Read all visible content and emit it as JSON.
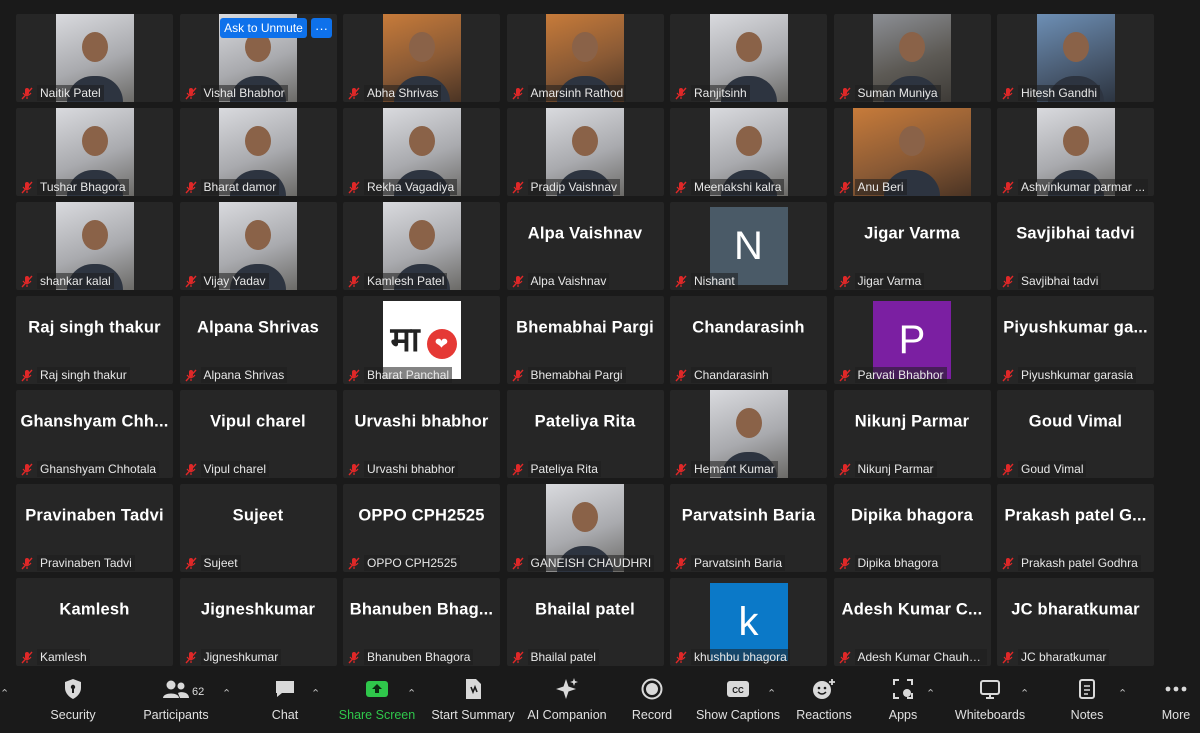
{
  "participants": [
    {
      "name": "Naitik Patel",
      "type": "video",
      "tone": "light"
    },
    {
      "name": "Vishal Bhabhor",
      "type": "video",
      "tone": "light"
    },
    {
      "name": "Abha Shrivas",
      "type": "video",
      "tone": "warm"
    },
    {
      "name": "Amarsinh Rathod",
      "type": "video",
      "tone": "warm"
    },
    {
      "name": "Ranjitsinh",
      "type": "video",
      "tone": "light"
    },
    {
      "name": "Suman Muniya",
      "type": "video",
      "tone": "dark"
    },
    {
      "name": "Hitesh Gandhi",
      "type": "video",
      "tone": "blue"
    },
    {
      "name": "Tushar Bhagora",
      "type": "video",
      "tone": "light"
    },
    {
      "name": "Bharat damor",
      "type": "video",
      "tone": "light"
    },
    {
      "name": "Rekha Vagadiya",
      "type": "video",
      "tone": "light"
    },
    {
      "name": "Pradip Vaishnav",
      "type": "video",
      "tone": "light"
    },
    {
      "name": "Meenakshi kalra",
      "type": "video",
      "tone": "light"
    },
    {
      "name": "Anu Beri",
      "type": "video",
      "tone": "warm",
      "wide": true
    },
    {
      "name": "Ashvinkumar parmar ...",
      "type": "video",
      "tone": "light"
    },
    {
      "name": "shankar kalal",
      "type": "video",
      "tone": "light"
    },
    {
      "name": "Vijay Yadav",
      "type": "video",
      "tone": "light"
    },
    {
      "name": "Kamlesh Patel",
      "type": "video",
      "tone": "light"
    },
    {
      "name": "Alpa Vaishnav",
      "type": "name",
      "display": "Alpa Vaishnav"
    },
    {
      "name": "Nishant",
      "type": "avatar",
      "letter": "N",
      "color": "#4a5a67"
    },
    {
      "name": "Jigar Varma",
      "type": "name",
      "display": "Jigar Varma"
    },
    {
      "name": "Savjibhai tadvi",
      "type": "name",
      "display": "Savjibhai tadvi"
    },
    {
      "name": "Raj singh thakur",
      "type": "name",
      "display": "Raj singh thakur"
    },
    {
      "name": "Alpana Shrivas",
      "type": "name",
      "display": "Alpana Shrivas"
    },
    {
      "name": "Bharat Panchal",
      "type": "maa"
    },
    {
      "name": "Bhemabhai Pargi",
      "type": "name",
      "display": "Bhemabhai Pargi"
    },
    {
      "name": "Chandarasinh",
      "type": "name",
      "display": "Chandarasinh"
    },
    {
      "name": "Parvati Bhabhor",
      "type": "avatar",
      "letter": "P",
      "color": "#7b1fa2"
    },
    {
      "name": "Piyushkumar garasia",
      "type": "name",
      "display": "Piyushkumar  ga..."
    },
    {
      "name": "Ghanshyam Chhotala",
      "type": "name",
      "display": "Ghanshyam  Chh..."
    },
    {
      "name": "Vipul charel",
      "type": "name",
      "display": "Vipul charel"
    },
    {
      "name": "Urvashi bhabhor",
      "type": "name",
      "display": "Urvashi bhabhor"
    },
    {
      "name": "Pateliya Rita",
      "type": "name",
      "display": "Pateliya Rita"
    },
    {
      "name": "Hemant Kumar",
      "type": "video",
      "tone": "light"
    },
    {
      "name": "Nikunj Parmar",
      "type": "name",
      "display": "Nikunj Parmar"
    },
    {
      "name": "Goud Vimal",
      "type": "name",
      "display": "Goud Vimal"
    },
    {
      "name": "Pravinaben Tadvi",
      "type": "name",
      "display": "Pravinaben Tadvi"
    },
    {
      "name": "Sujeet",
      "type": "name",
      "display": "Sujeet"
    },
    {
      "name": "OPPO CPH2525",
      "type": "name",
      "display": "OPPO CPH2525"
    },
    {
      "name": "GANEISH CHAUDHRI",
      "type": "video",
      "tone": "light"
    },
    {
      "name": "Parvatsinh Baria",
      "type": "name",
      "display": "Parvatsinh Baria"
    },
    {
      "name": "Dipika bhagora",
      "type": "name",
      "display": "Dipika bhagora"
    },
    {
      "name": "Prakash patel Godhra",
      "type": "name",
      "display": "Prakash  patel  G..."
    },
    {
      "name": "Kamlesh",
      "type": "name",
      "display": "Kamlesh"
    },
    {
      "name": "Jigneshkumar",
      "type": "name",
      "display": "Jigneshkumar"
    },
    {
      "name": "Bhanuben Bhagora",
      "type": "name",
      "display": "Bhanuben  Bhag..."
    },
    {
      "name": "Bhailal  patel",
      "type": "name",
      "display": "Bhailal  patel"
    },
    {
      "name": "khushbu bhagora",
      "type": "avatar",
      "letter": "k",
      "color": "#0b79c8"
    },
    {
      "name": "Adesh Kumar Chauhan...",
      "type": "name",
      "display": "Adesh  Kumar  C..."
    },
    {
      "name": "JC bharatkumar",
      "type": "name",
      "display": "JC bharatkumar"
    }
  ],
  "hover": {
    "unmute_label": "Ask to Unmute",
    "more_label": "···"
  },
  "toolbar": {
    "security": "Security",
    "participants": "Participants",
    "participants_count": "62",
    "chat": "Chat",
    "share_screen": "Share Screen",
    "start_summary": "Start Summary",
    "ai_companion": "AI Companion",
    "record": "Record",
    "captions": "Show Captions",
    "reactions": "Reactions",
    "apps": "Apps",
    "whiteboards": "Whiteboards",
    "notes": "Notes",
    "more": "More"
  },
  "colors": {
    "accent": "#0e71eb",
    "share_green": "#2fc74b",
    "muted_red": "#e02828"
  }
}
